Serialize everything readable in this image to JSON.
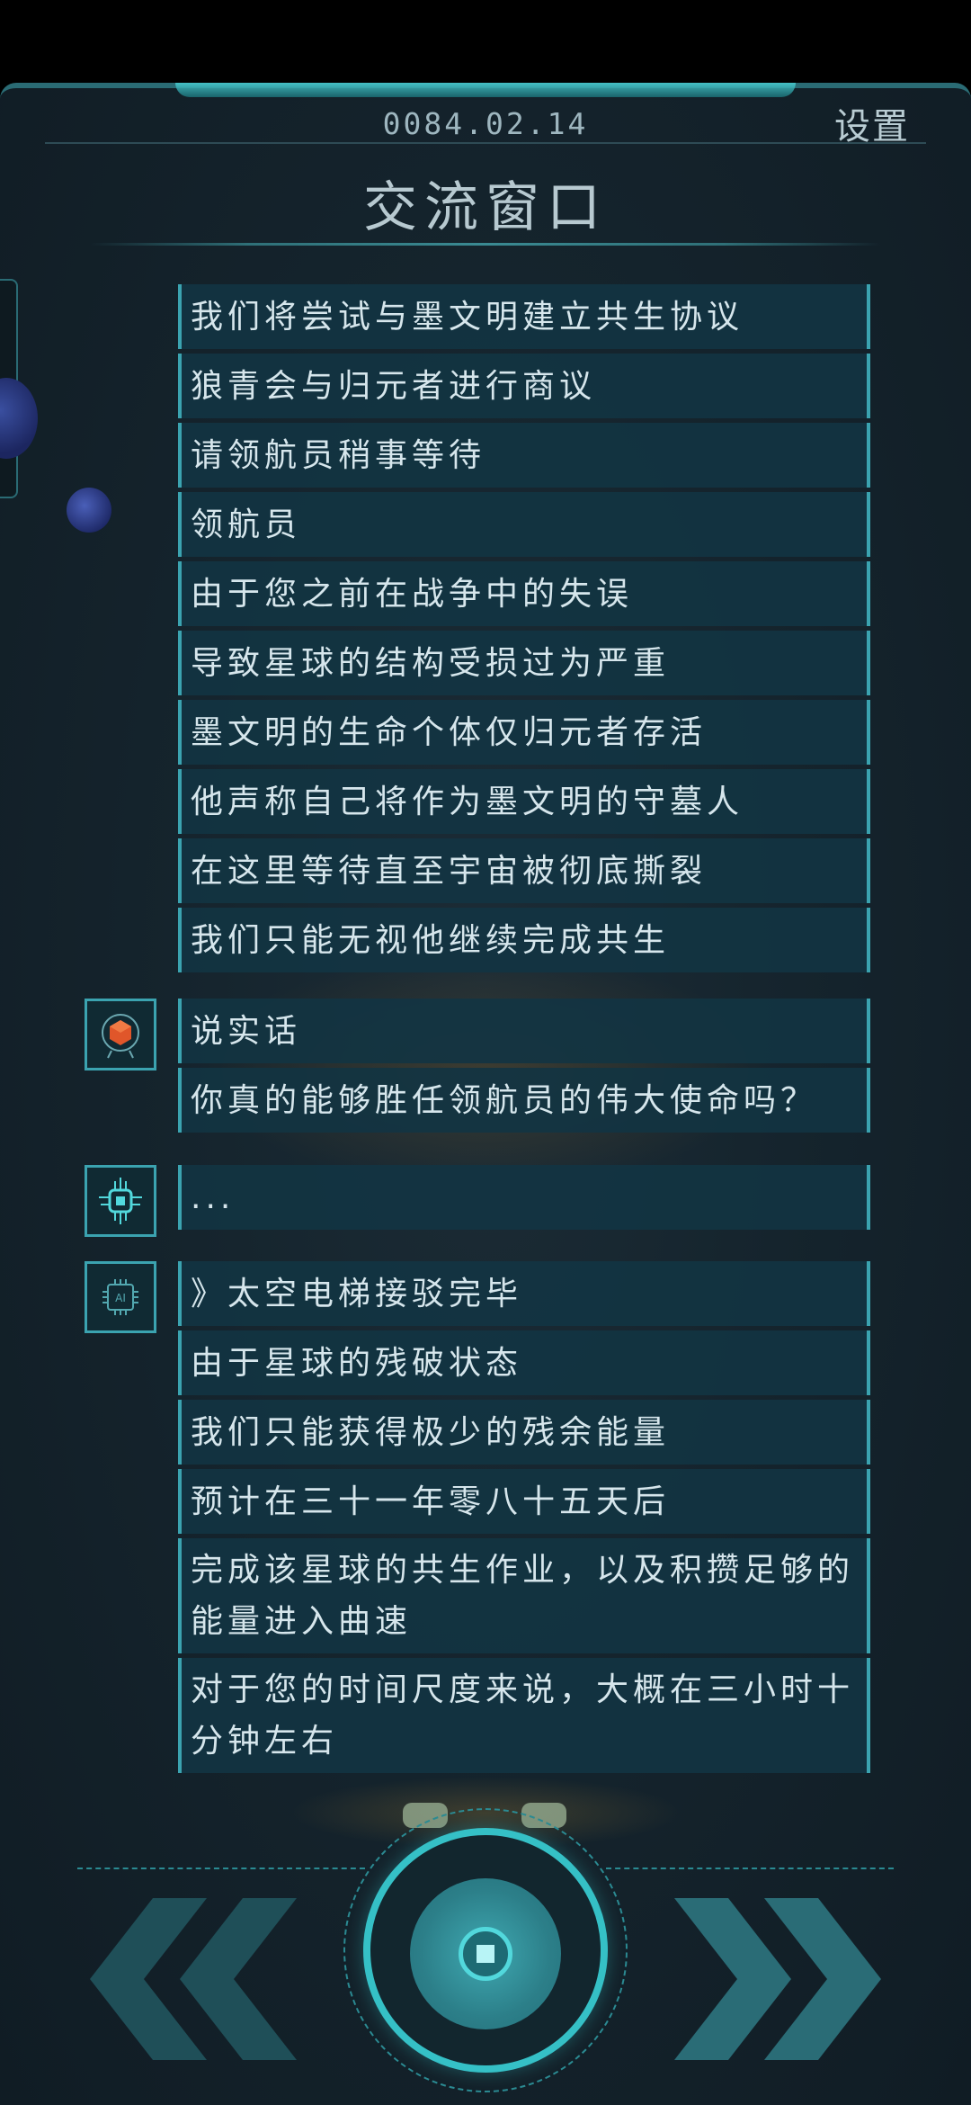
{
  "header": {
    "date": "0084.02.14",
    "settings_label": "设置",
    "title": "交流窗口"
  },
  "messages_group_a": [
    "我们将尝试与墨文明建立共生协议",
    "狼青会与归元者进行商议",
    "请领航员稍事等待",
    "领航员",
    "由于您之前在战争中的失误",
    "导致星球的结构受损过为严重",
    "墨文明的生命个体仅归元者存活",
    "他声称自己将作为墨文明的守墓人",
    "在这里等待直至宇宙被彻底撕裂",
    "我们只能无视他继续完成共生"
  ],
  "messages_group_b": [
    "说实话",
    "你真的能够胜任领航员的伟大使命吗？"
  ],
  "messages_group_c": [
    "..."
  ],
  "messages_group_d": [
    "》太空电梯接驳完毕",
    "由于星球的残破状态",
    "我们只能获得极少的残余能量",
    "预计在三十一年零八十五天后",
    "完成该星球的共生作业，以及积攒足够的能量进入曲速",
    "对于您的时间尺度来说，大概在三小时十分钟左右"
  ],
  "avatars": {
    "group_b": "orange-cube-avatar-icon",
    "group_c": "robot-chip-avatar-icon",
    "group_d": "ai-chip-avatar-icon"
  },
  "colors": {
    "accent": "#3ba3b0",
    "panel_bg": "#15242d",
    "bubble_bg": "#123442",
    "text": "#d6e6ec"
  }
}
